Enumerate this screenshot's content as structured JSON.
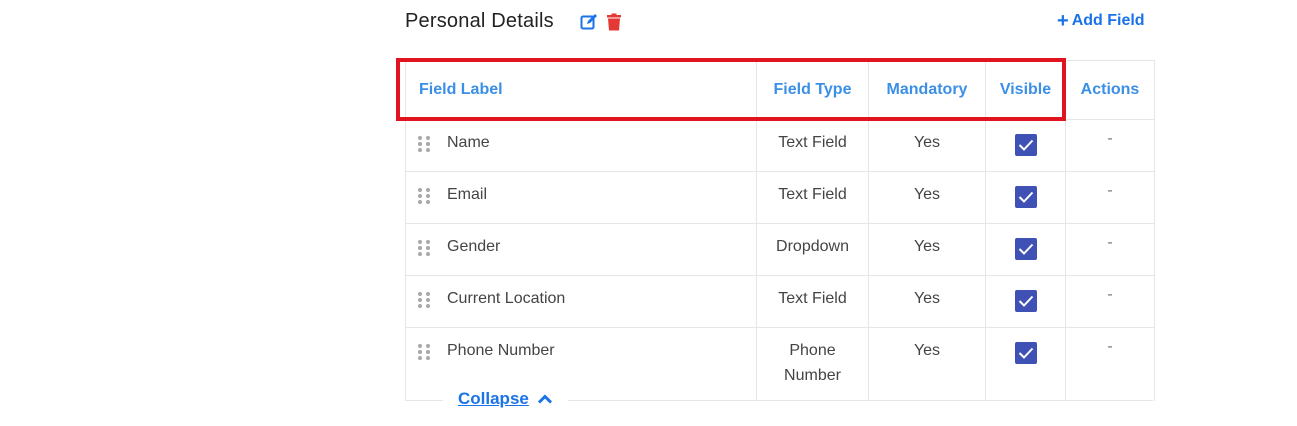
{
  "section": {
    "title": "Personal Details",
    "add_field_label": "Add Field"
  },
  "table": {
    "headers": {
      "field_label": "Field Label",
      "field_type": "Field Type",
      "mandatory": "Mandatory",
      "visible": "Visible",
      "actions": "Actions"
    },
    "rows": [
      {
        "label": "Name",
        "type": "Text Field",
        "mandatory": "Yes",
        "visible": true,
        "actions": "-"
      },
      {
        "label": "Email",
        "type": "Text Field",
        "mandatory": "Yes",
        "visible": true,
        "actions": "-"
      },
      {
        "label": "Gender",
        "type": "Dropdown",
        "mandatory": "Yes",
        "visible": true,
        "actions": "-"
      },
      {
        "label": "Current Location",
        "type": "Text Field",
        "mandatory": "Yes",
        "visible": true,
        "actions": "-"
      },
      {
        "label": "Phone Number",
        "type": "Phone Number",
        "mandatory": "Yes",
        "visible": true,
        "actions": "-"
      }
    ]
  },
  "collapse_label": "Collapse",
  "colors": {
    "accent": "#1a73e8",
    "header_text": "#3b8fe6",
    "checkbox": "#3f51b5",
    "delete": "#e53935",
    "highlight": "#e0141e"
  },
  "icons": [
    "edit-icon",
    "trash-icon",
    "plus-icon",
    "drag-handle-icon",
    "checkmark-icon",
    "chevron-up-icon"
  ]
}
